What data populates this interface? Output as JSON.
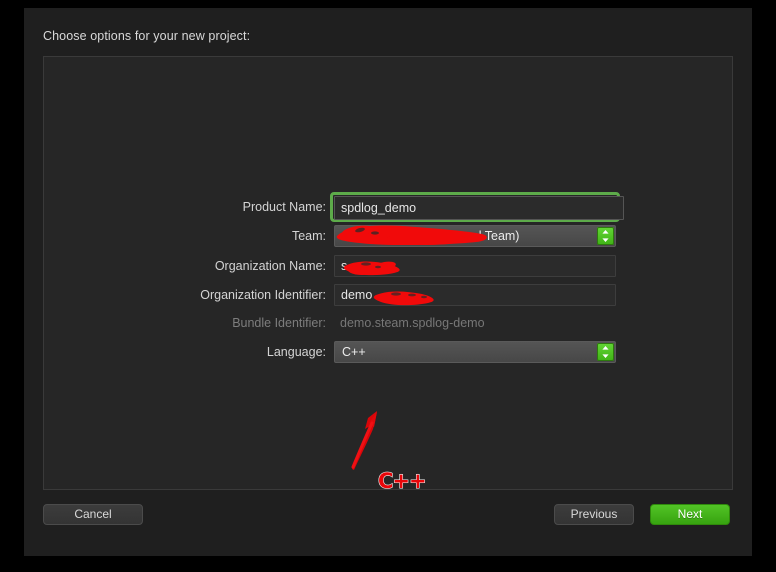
{
  "window": {
    "prompt": "Choose options for your new project:"
  },
  "form": {
    "fields": [
      {
        "label": "Product Name:",
        "type": "text",
        "value": "spdlog_demo",
        "focused": true,
        "redacted": false
      },
      {
        "label": "Team:",
        "type": "popup",
        "value": "(Personal Team)",
        "focused": false,
        "redacted": true
      },
      {
        "label": "Organization Name:",
        "type": "text",
        "value": "s",
        "focused": false,
        "redacted": true
      },
      {
        "label": "Organization Identifier:",
        "type": "text",
        "value": "demo",
        "focused": false,
        "redacted": true
      },
      {
        "label": "Bundle Identifier:",
        "type": "readonly",
        "value": "demo.steam.spdlog-demo",
        "focused": false,
        "redacted": false
      },
      {
        "label": "Language:",
        "type": "popup",
        "value": "C++",
        "focused": false,
        "redacted": false
      }
    ]
  },
  "annotation": {
    "arrow_icon": "red-arrow-up-right-icon",
    "text": "C++",
    "color": "#e8060a"
  },
  "buttons": {
    "cancel": "Cancel",
    "previous": "Previous",
    "next": "Next"
  },
  "colors": {
    "accent_green": "#3fb215",
    "focus_ring": "#5dab4a",
    "panel_bg": "#262626",
    "window_bg": "#1f1f1f",
    "redaction": "#f10a0a"
  }
}
